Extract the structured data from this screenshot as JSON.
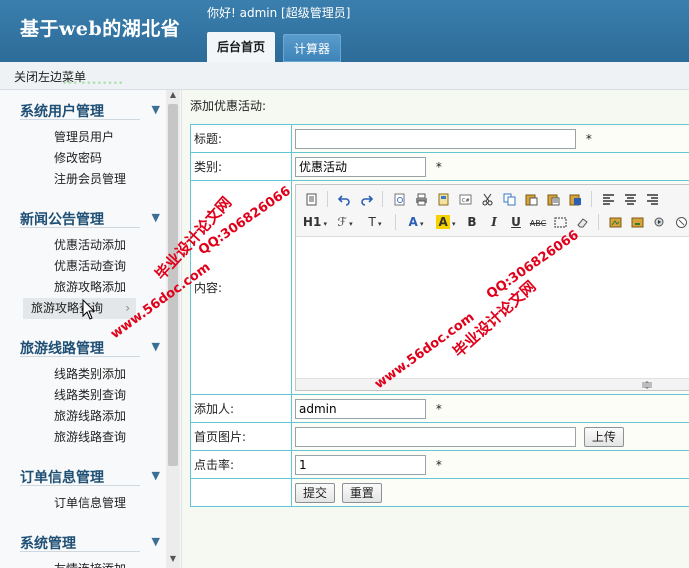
{
  "header": {
    "app_title": "基于web的湖北省",
    "welcome_text": "你好! admin [超级管理员]",
    "tabs": [
      {
        "label": "后台首页",
        "active": true
      },
      {
        "label": "计算器",
        "active": false
      }
    ]
  },
  "toolbar": {
    "close_sidebar_label": "关闭左边菜单",
    "ghost_text": "••• ••••••••"
  },
  "sidebar": {
    "groups": [
      {
        "title": "系统用户管理",
        "items": [
          "管理员用户",
          "修改密码",
          "注册会员管理"
        ]
      },
      {
        "title": "新闻公告管理",
        "items": [
          "优惠活动添加",
          "优惠活动查询",
          "旅游攻略添加",
          "旅游攻略查询"
        ]
      },
      {
        "title": "旅游线路管理",
        "items": [
          "线路类别添加",
          "线路类别查询",
          "旅游线路添加",
          "旅游线路查询"
        ]
      },
      {
        "title": "订单信息管理",
        "items": [
          "订单信息管理"
        ]
      },
      {
        "title": "系统管理",
        "items": [
          "友情连接添加"
        ]
      }
    ],
    "hovered_item": "旅游攻略查询"
  },
  "main": {
    "page_heading": "添加优惠活动:",
    "form": {
      "title_label": "标题:",
      "title_value": "",
      "category_label": "类别:",
      "category_value": "优惠活动",
      "content_label": "内容:",
      "author_label": "添加人:",
      "author_value": "admin",
      "image_label": "首页图片:",
      "image_value": "",
      "upload_label": "上传",
      "clicks_label": "点击率:",
      "clicks_value": "1",
      "required_mark": "*",
      "submit_label": "提交",
      "reset_label": "重置"
    },
    "editor": {
      "heading_button": "H1",
      "font_button": "ℱ",
      "size_button": "T",
      "bold_button": "B",
      "italic_button": "I",
      "underline_button": "U",
      "strike_button": "ABC"
    }
  },
  "watermarks": {
    "site_name": "毕业设计论文网",
    "site_url": "www.56doc.com",
    "qq": "QQ:306826066"
  },
  "colors": {
    "header_bg": "#2d6b98",
    "sidebar_title": "#1f4f74",
    "table_border": "#64c6d3",
    "watermark": "#e0001a"
  }
}
